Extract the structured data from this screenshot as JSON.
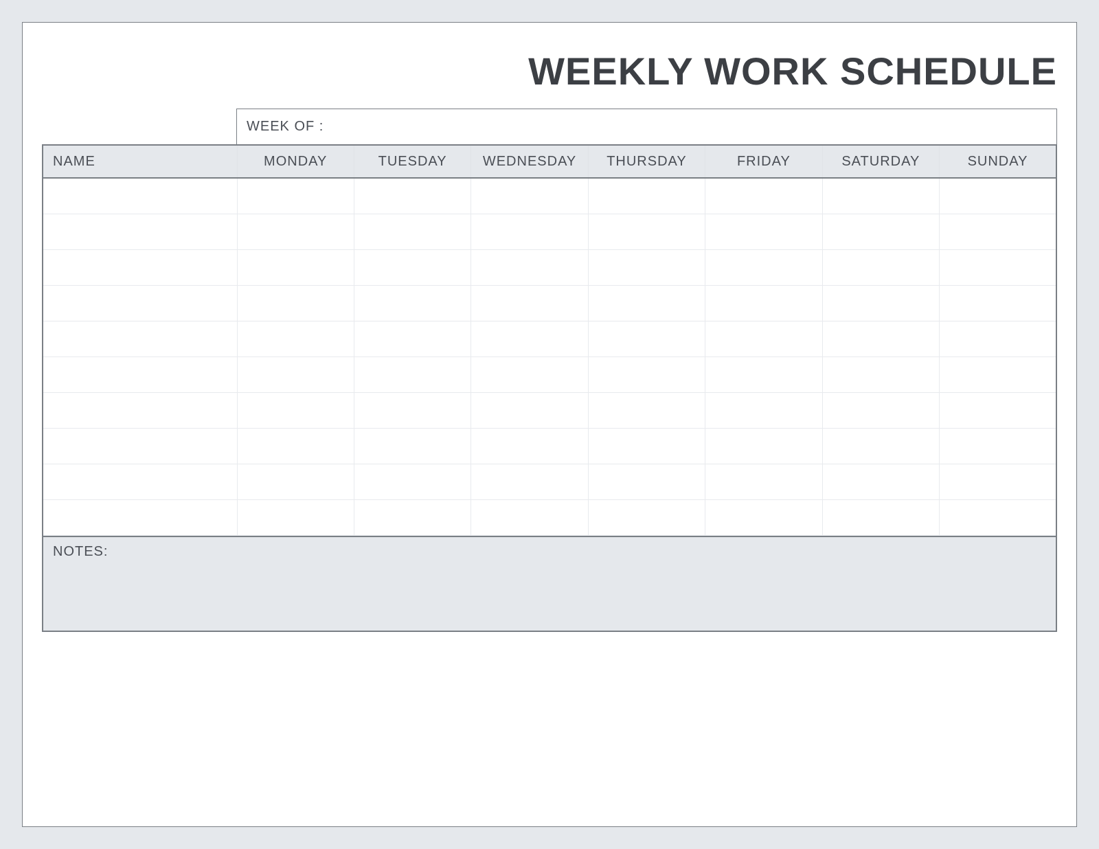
{
  "title": "WEEKLY WORK SCHEDULE",
  "weekOfLabel": "WEEK OF :",
  "headers": {
    "name": "NAME",
    "days": [
      "MONDAY",
      "TUESDAY",
      "WEDNESDAY",
      "THURSDAY",
      "FRIDAY",
      "SATURDAY",
      "SUNDAY"
    ]
  },
  "rows": [
    {
      "name": "",
      "cells": [
        "",
        "",
        "",
        "",
        "",
        "",
        ""
      ]
    },
    {
      "name": "",
      "cells": [
        "",
        "",
        "",
        "",
        "",
        "",
        ""
      ]
    },
    {
      "name": "",
      "cells": [
        "",
        "",
        "",
        "",
        "",
        "",
        ""
      ]
    },
    {
      "name": "",
      "cells": [
        "",
        "",
        "",
        "",
        "",
        "",
        ""
      ]
    },
    {
      "name": "",
      "cells": [
        "",
        "",
        "",
        "",
        "",
        "",
        ""
      ]
    },
    {
      "name": "",
      "cells": [
        "",
        "",
        "",
        "",
        "",
        "",
        ""
      ]
    },
    {
      "name": "",
      "cells": [
        "",
        "",
        "",
        "",
        "",
        "",
        ""
      ]
    },
    {
      "name": "",
      "cells": [
        "",
        "",
        "",
        "",
        "",
        "",
        ""
      ]
    },
    {
      "name": "",
      "cells": [
        "",
        "",
        "",
        "",
        "",
        "",
        ""
      ]
    },
    {
      "name": "",
      "cells": [
        "",
        "",
        "",
        "",
        "",
        "",
        ""
      ]
    }
  ],
  "notesLabel": "NOTES:",
  "colWidthName": 283,
  "colWidthDay": 117
}
